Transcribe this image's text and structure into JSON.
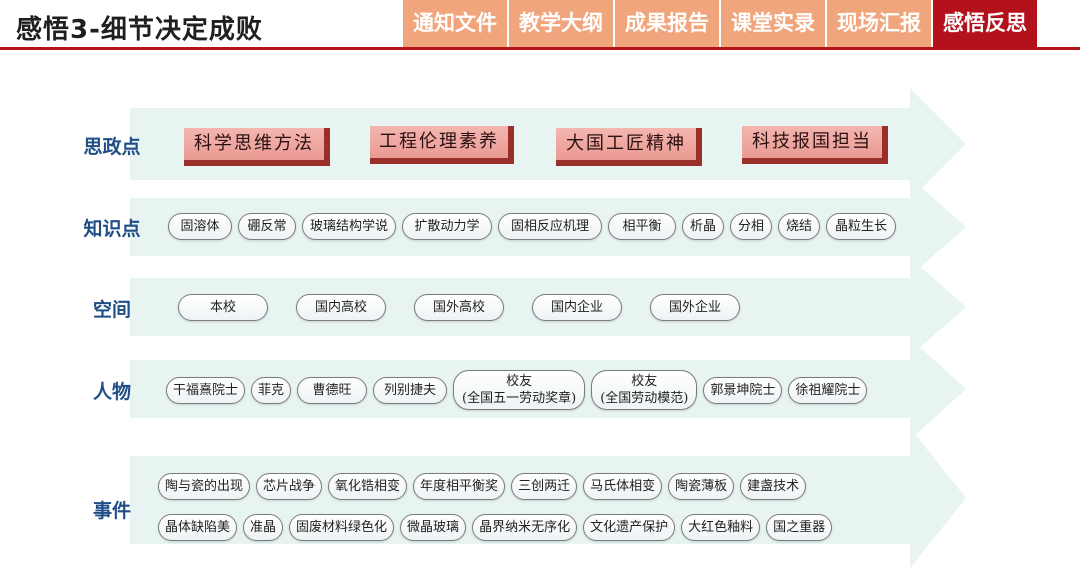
{
  "header": {
    "title": "感悟3-细节决定成败",
    "tabs": [
      {
        "label": "通知文件",
        "active": false
      },
      {
        "label": "教学大纲",
        "active": false
      },
      {
        "label": "成果报告",
        "active": false
      },
      {
        "label": "课堂实录",
        "active": false
      },
      {
        "label": "现场汇报",
        "active": false
      },
      {
        "label": "感悟反思",
        "active": true
      }
    ],
    "colors": {
      "tab": "#f0a57c",
      "tab_active": "#b3121c",
      "rule": "#b5121b"
    }
  },
  "rows": {
    "ideology": {
      "label": "思政点",
      "items": [
        "科学思维方法",
        "工程伦理素养",
        "大国工匠精神",
        "科技报国担当"
      ]
    },
    "knowledge": {
      "label": "知识点",
      "items": [
        "固溶体",
        "硼反常",
        "玻璃结构学说",
        "扩散动力学",
        "固相反应机理",
        "相平衡",
        "析晶",
        "分相",
        "烧结",
        "晶粒生长"
      ]
    },
    "space": {
      "label": "空间",
      "items": [
        "本校",
        "国内高校",
        "国外高校",
        "国内企业",
        "国外企业"
      ]
    },
    "people": {
      "label": "人物",
      "items": [
        {
          "line1": "干福熹院士"
        },
        {
          "line1": "菲克"
        },
        {
          "line1": "曹德旺"
        },
        {
          "line1": "列别捷夫"
        },
        {
          "line1": "校友",
          "line2": "(全国五一劳动奖章)"
        },
        {
          "line1": "校友",
          "line2": "(全国劳动模范)"
        },
        {
          "line1": "郭景坤院士"
        },
        {
          "line1": "徐祖耀院士"
        }
      ]
    },
    "events": {
      "label": "事件",
      "items_row1": [
        "陶与瓷的出现",
        "芯片战争",
        "氧化锆相变",
        "年度相平衡奖",
        "三创两迁",
        "马氏体相变",
        "陶瓷薄板",
        "建盏技术"
      ],
      "items_row2": [
        "晶体缺陷美",
        "准晶",
        "固废材料绿色化",
        "微晶玻璃",
        "晶界纳米无序化",
        "文化遗产保护",
        "大红色釉料",
        "国之重器"
      ]
    }
  },
  "colors": {
    "band": "#e8f4f1",
    "label": "#1f4e86",
    "ideology_chip": "#f2aca4"
  }
}
